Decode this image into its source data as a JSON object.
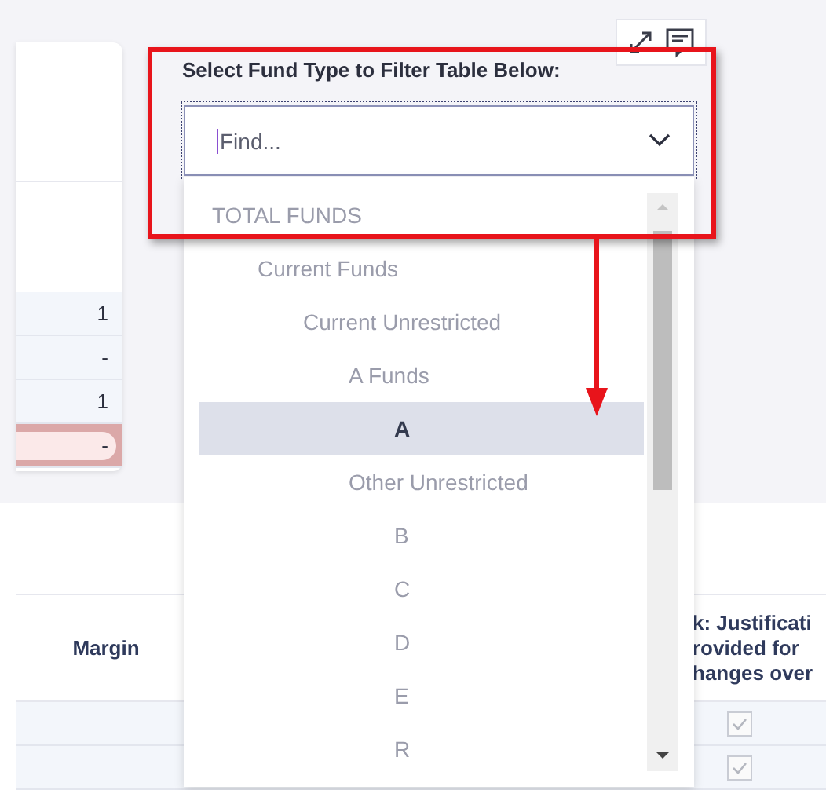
{
  "left_card": {
    "rows": [
      {
        "value": "1",
        "flagged": false
      },
      {
        "value": "-",
        "flagged": false
      },
      {
        "value": "1",
        "flagged": false
      },
      {
        "value": "-",
        "flagged": true
      }
    ]
  },
  "table": {
    "columns": [
      {
        "lines": [
          "Margin"
        ]
      },
      {
        "lines": [
          "k: Justificati",
          "rovided for",
          "hanges over"
        ]
      }
    ],
    "rows": [
      {
        "checked": true
      },
      {
        "checked": true
      }
    ]
  },
  "filter": {
    "label": "Select Fund Type to Filter Table Below:",
    "placeholder": "Find...",
    "expanded": true,
    "options": [
      {
        "label": "TOTAL FUNDS",
        "selected": false,
        "children": [
          {
            "label": "Current Funds",
            "selected": false,
            "children": [
              {
                "label": "Current Unrestricted",
                "selected": false,
                "children": [
                  {
                    "label": "A Funds",
                    "selected": false,
                    "children": [
                      {
                        "label": "A",
                        "selected": true
                      }
                    ]
                  },
                  {
                    "label": "Other Unrestricted",
                    "selected": false,
                    "children": [
                      {
                        "label": "B",
                        "selected": false
                      },
                      {
                        "label": "C",
                        "selected": false
                      },
                      {
                        "label": "D",
                        "selected": false
                      },
                      {
                        "label": "E",
                        "selected": false
                      },
                      {
                        "label": "R",
                        "selected": false
                      }
                    ]
                  }
                ]
              }
            ]
          }
        ]
      }
    ]
  }
}
